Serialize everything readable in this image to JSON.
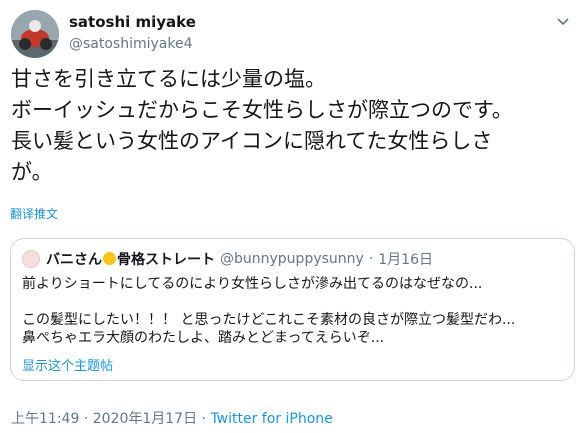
{
  "author": {
    "name": "satoshi miyake",
    "handle": "@satoshimiyake4",
    "avatar_icon": "avatar-motorcycle-photo"
  },
  "tweet": {
    "text": "甘さを引き立てるには少量の塩。\nボーイッシュだからこそ女性らしさが際立つのです。\n長い髪という女性のアイコンに隠れてた女性らしさ\nが。",
    "translate_label": "翻译推文"
  },
  "quoted": {
    "name_prefix": "バニさん",
    "name_suffix": "骨格ストレート",
    "handle": "@bunnypuppysunny",
    "separator": "·",
    "date": "1月16日",
    "lines": [
      "前よりショートにしてるのにより女性らしさが滲み出てるのはなぜなの...",
      "この髪型にしたい！！！ と思ったけどこれこそ素材の良さが際立つ髪型だわ...",
      "鼻ぺちゃエラ大顔のわたしよ、踏みとどまってえらいぞ..."
    ],
    "show_thread": "显示这个主题帖"
  },
  "meta": {
    "time": "上午11:49",
    "separator": " · ",
    "date": "2020年1月17日",
    "source": "Twitter for iPhone"
  },
  "colors": {
    "accent": "#1b95e0",
    "secondary_text": "#657786",
    "border": "#ccd6dd"
  }
}
